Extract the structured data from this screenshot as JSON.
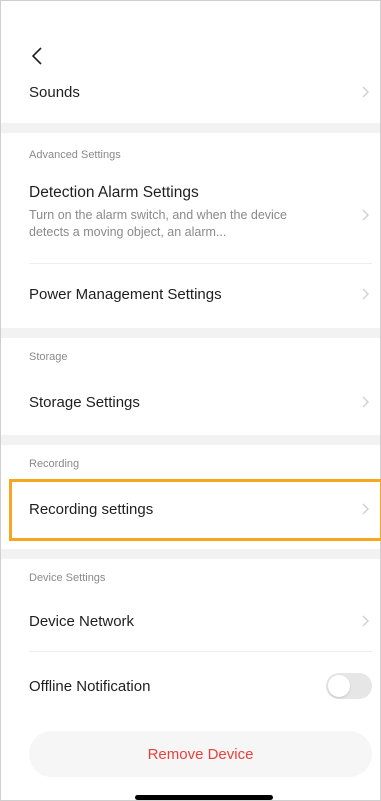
{
  "header": {
    "back_icon": "chevron-left-icon"
  },
  "rows": {
    "sounds": "Sounds",
    "detection_title": "Detection Alarm Settings",
    "detection_desc": "Turn on the alarm switch, and when the device detects a moving object, an alarm...",
    "power": "Power Management Settings",
    "storage": "Storage Settings",
    "recording": "Recording settings",
    "network": "Device Network",
    "offline": "Offline Notification"
  },
  "sections": {
    "advanced": "Advanced Settings",
    "storage": "Storage",
    "recording": "Recording",
    "device": "Device Settings"
  },
  "toggles": {
    "offline_notification": false
  },
  "actions": {
    "remove_device": "Remove Device"
  },
  "colors": {
    "highlight": "#f5a623",
    "danger": "#e8423f",
    "separator": "#f2f2f2"
  }
}
